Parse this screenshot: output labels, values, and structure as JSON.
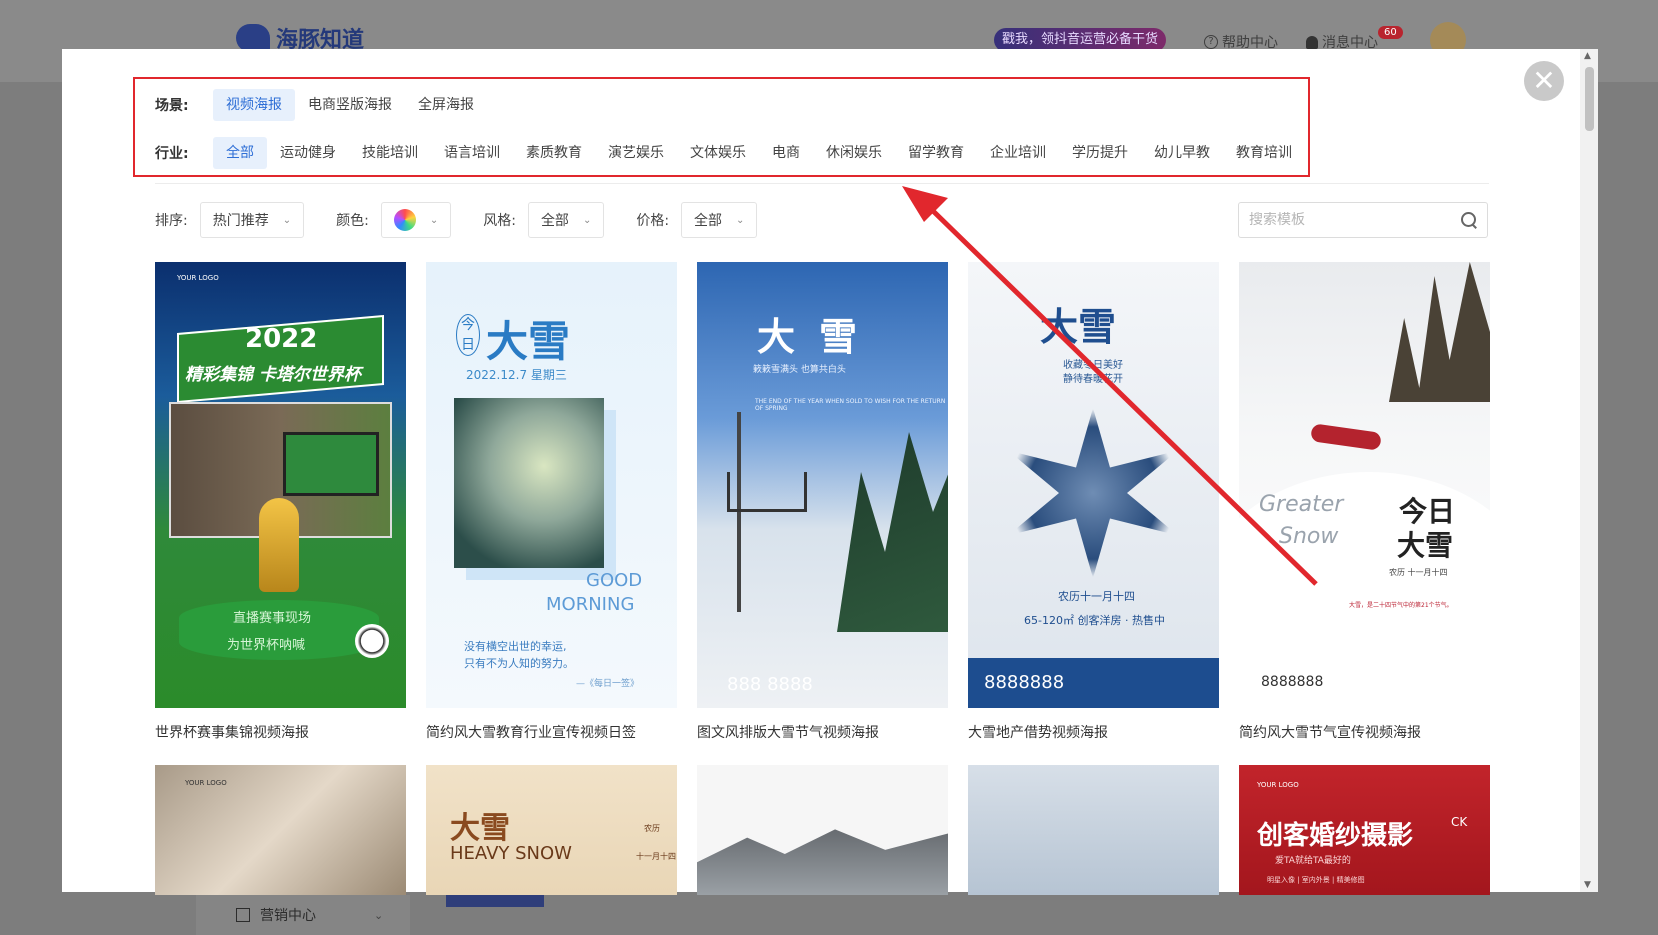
{
  "background_app": {
    "logo_text": "海豚知道",
    "promo_text": "戳我，领抖音运营必备干货",
    "help_label": "帮助中心",
    "message_label": "消息中心",
    "message_count": "60",
    "footer_nav_label": "营销中心"
  },
  "filters": {
    "scene_label": "场景:",
    "scenes": [
      "视频海报",
      "电商竖版海报",
      "全屏海报"
    ],
    "active_scene": "视频海报",
    "industry_label": "行业:",
    "industries": [
      "全部",
      "运动健身",
      "技能培训",
      "语言培训",
      "素质教育",
      "演艺娱乐",
      "文体娱乐",
      "电商",
      "休闲娱乐",
      "留学教育",
      "企业培训",
      "学历提升",
      "幼儿早教",
      "教育培训"
    ],
    "active_industry": "全部"
  },
  "sort_bar": {
    "sort_label": "排序:",
    "sort_value": "热门推荐",
    "color_label": "颜色:",
    "style_label": "风格:",
    "style_value": "全部",
    "price_label": "价格:",
    "price_value": "全部"
  },
  "search": {
    "placeholder": "搜索模板"
  },
  "templates": [
    {
      "caption": "世界杯赛事集锦视频海报",
      "logo": "YOUR LOGO",
      "year": "2022",
      "headline": "精彩集锦 卡塔尔世界杯",
      "line1": "直播赛事现场",
      "line2": "为世界杯呐喊"
    },
    {
      "caption": "简约风大雪教育行业宣传视频日签",
      "today": "今日",
      "headline": "大雪",
      "date": "2022.12.7 星期三",
      "good": "GOOD",
      "morning": "MORNING",
      "quote1": "没有横空出世的幸运,",
      "quote2": "只有不为人知的努力。",
      "signature": "—《每日一签》"
    },
    {
      "caption": "图文风排版大雪节气视频海报",
      "headline": "大雪",
      "sub": "簌簌雪满头 也算共白头",
      "small": "THE END OF THE YEAR WHEN SOLD TO WISH FOR THE RETURN OF SPRING",
      "phone": "888 8888"
    },
    {
      "caption": "大雪地产借势视频海报",
      "headline": "大雪",
      "sub1": "收藏冬日美好",
      "sub2": "静待春暖花开",
      "date": "农历十一月十四",
      "info": "65-120㎡ 创客洋房 · 热售中",
      "phone": "8888888"
    },
    {
      "caption": "简约风大雪节气宣传视频海报",
      "script1": "Greater",
      "script2": "Snow",
      "big1": "今日",
      "big2": "大雪",
      "tag": "农历 十一月十四",
      "para": "大雪，是二十四节气中的第21个节气。",
      "phone": "8888888"
    }
  ],
  "templates_row2": [
    {
      "logo": "YOUR LOGO"
    },
    {
      "headline": "大雪",
      "en": "HEAVY SNOW",
      "side1": "农历",
      "side2": "十一月十四"
    },
    {},
    {},
    {
      "logo": "YOUR LOGO",
      "headline": "创客婚纱摄影",
      "ck": "CK",
      "sub": "爱TA就给TA最好的",
      "tags": "明星入像 | 室内外景 | 精美修图"
    }
  ],
  "colors": {
    "accent": "#2f6fd6",
    "active_chip_bg": "#e7f0fc",
    "annotation_red": "#e1272d"
  },
  "icons": [
    "close-icon",
    "search-icon",
    "chevron-down-icon",
    "color-swatch-icon",
    "bell-icon",
    "help-icon"
  ]
}
